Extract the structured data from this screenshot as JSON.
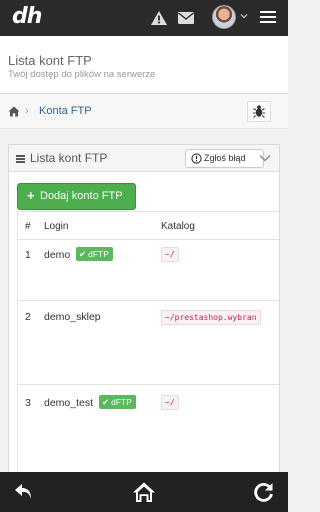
{
  "topbar": {
    "logo": "dh",
    "icons": [
      "warning-icon",
      "envelope-icon",
      "avatar",
      "chevron-down-icon",
      "menu-icon"
    ]
  },
  "header": {
    "title": "Lista kont FTP",
    "subtitle": "Twój dostęp do plików na serwerze"
  },
  "breadcrumb": {
    "home_icon": "home-icon",
    "separator": "›",
    "current": "Konta FTP",
    "bug_icon": "bug-icon"
  },
  "panel": {
    "title": "Lista kont FTP",
    "report_button": "Zgłoś błąd",
    "add_button": "Dodaj konto FTP",
    "table": {
      "headers": [
        "#",
        "Login",
        "Katalog"
      ],
      "rows": [
        {
          "num": "1",
          "login": "demo",
          "badge": "dFTP",
          "dir": "~/"
        },
        {
          "num": "2",
          "login": "demo_sklep",
          "badge": "",
          "dir": "~/prestashop.wybran"
        },
        {
          "num": "3",
          "login": "demo_test",
          "badge": "dFTP",
          "dir": "~/"
        }
      ]
    }
  },
  "bottombar": {
    "icons": [
      "back-icon",
      "home-icon",
      "refresh-icon"
    ]
  },
  "colors": {
    "topbar": "#2b2b2b",
    "success": "#5cb85c",
    "link": "#2a6496",
    "code_text": "#c7254e"
  }
}
